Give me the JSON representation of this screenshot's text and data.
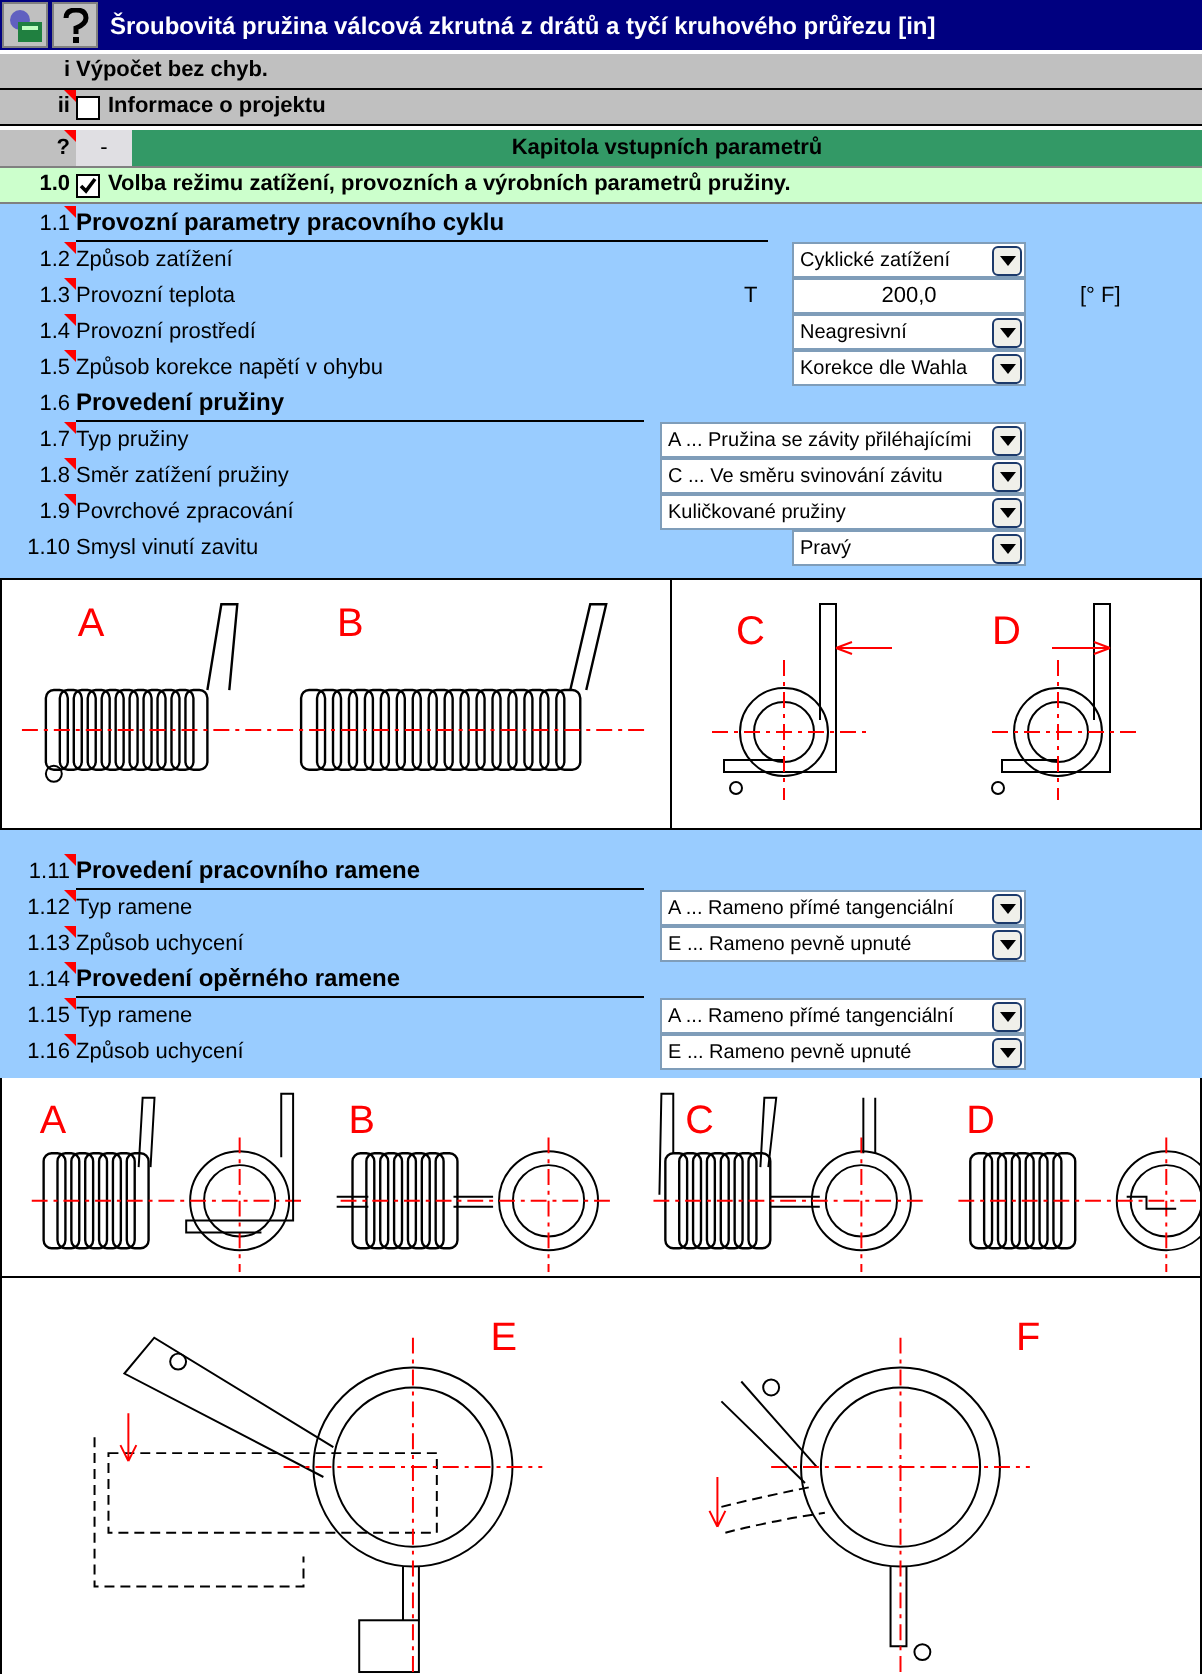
{
  "window": {
    "title": "Šroubovitá pružina válcová zkrutná z drátů a tyčí kruhového průřezu [in]"
  },
  "status": {
    "num": "i",
    "text": "Výpočet bez chyb.",
    "note": false
  },
  "project": {
    "num": "ii",
    "text": "Informace o projektu",
    "checked": false,
    "note": true
  },
  "chapter": {
    "num": "?",
    "button": "-",
    "title": "Kapitola vstupních parametrů",
    "note": true
  },
  "section": {
    "num": "1.0",
    "text": "Volba režimu zatížení, provozních a výrobních parametrů pružiny.",
    "checked": true,
    "note": false
  },
  "params": [
    {
      "kind": "heading",
      "num": "1.1",
      "label": "Provozní parametry pracovního cyklu",
      "note": true
    },
    {
      "kind": "select",
      "num": "1.2",
      "label": "Způsob zatížení",
      "value": "Cyklické zatížení",
      "note": true
    },
    {
      "kind": "input",
      "num": "1.3",
      "label": "Provozní teplota",
      "symbol": "T",
      "value": "200,0",
      "unit": "[° F]",
      "note": true
    },
    {
      "kind": "select",
      "num": "1.4",
      "label": "Provozní prostředí",
      "value": "Neagresivní",
      "note": true
    },
    {
      "kind": "select",
      "num": "1.5",
      "label": "Způsob korekce napětí v ohybu",
      "value": "Korekce dle Wahla",
      "note": true
    },
    {
      "kind": "heading",
      "num": "1.6",
      "label": "Provedení pružiny",
      "note": false
    },
    {
      "kind": "wide-select",
      "num": "1.7",
      "label": "Typ pružiny",
      "value": "A ... Pružina se závity přiléhajícími",
      "note": true
    },
    {
      "kind": "wide-select",
      "num": "1.8",
      "label": "Směr zatížení pružiny",
      "value": "C ... Ve směru svinování závitu",
      "note": true
    },
    {
      "kind": "wide-select",
      "num": "1.9",
      "label": "Povrchové zpracování",
      "value": "Kuličkované pružiny",
      "note": true
    },
    {
      "kind": "select",
      "num": "1.10",
      "label": "Smysl vinutí zavitu",
      "value": "Pravý",
      "note": false
    }
  ],
  "figure1": {
    "labels": [
      "A",
      "B",
      "C",
      "D"
    ]
  },
  "params2": [
    {
      "kind": "heading",
      "num": "1.11",
      "label": "Provedení pracovního ramene",
      "note": true
    },
    {
      "kind": "wide-select",
      "num": "1.12",
      "label": "Typ ramene",
      "value": "A ... Rameno přímé tangenciální",
      "note": true
    },
    {
      "kind": "wide-select",
      "num": "1.13",
      "label": "Způsob uchycení",
      "value": "E ... Rameno pevně upnuté",
      "note": true
    },
    {
      "kind": "heading",
      "num": "1.14",
      "label": "Provedení opěrného ramene",
      "note": true
    },
    {
      "kind": "wide-select",
      "num": "1.15",
      "label": "Typ ramene",
      "value": "A ... Rameno přímé tangenciální",
      "note": true
    },
    {
      "kind": "wide-select",
      "num": "1.16",
      "label": "Způsob uchycení",
      "value": "E ... Rameno pevně upnuté",
      "note": true
    }
  ],
  "figure2": {
    "labels": [
      "A",
      "B",
      "C",
      "D"
    ]
  },
  "figure3": {
    "labels": [
      "E",
      "F"
    ]
  }
}
